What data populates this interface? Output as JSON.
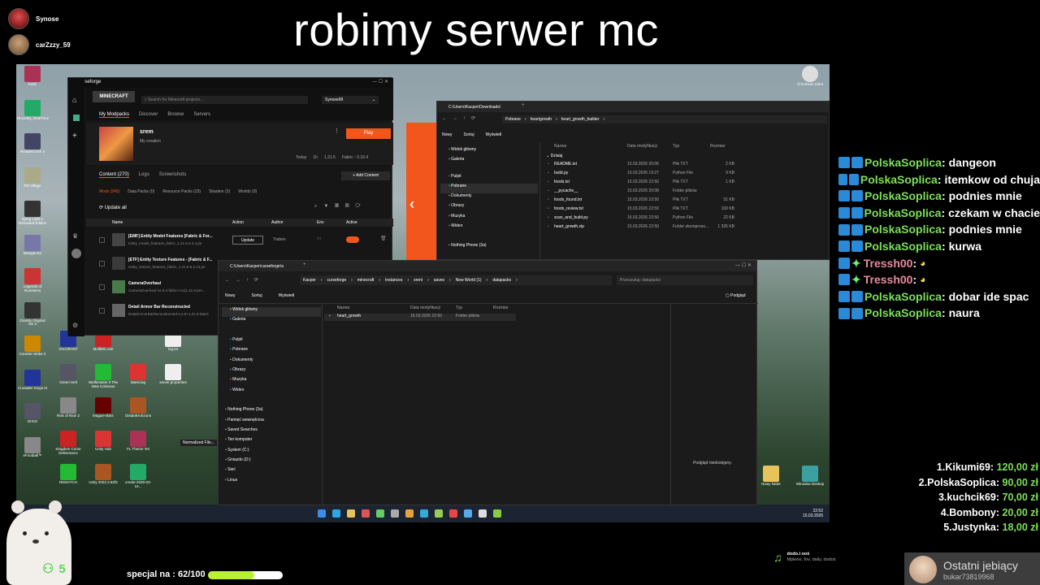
{
  "stream": {
    "title": "robimy serwer mc",
    "viewers": [
      {
        "name": "Synose"
      },
      {
        "name": "carZzzy_59"
      }
    ],
    "viewer_count": "5",
    "goal_text": "specjal na : 62/100",
    "goal_progress": 0.62,
    "music_title": "dodo.i ooś",
    "music_sub": "Mplene, fov, daily, dodoś",
    "last_donor_title": "Ostatni jebiący",
    "last_donor_name": "bukar73819968"
  },
  "chat": [
    {
      "user": "PolskaSoplica",
      "text": "dangeon",
      "color": "#7ce05a"
    },
    {
      "user": "PolskaSoplica",
      "text": "itemkow od chuja",
      "color": "#7ce05a"
    },
    {
      "user": "PolskaSoplica",
      "text": "podnies mnie",
      "color": "#7ce05a"
    },
    {
      "user": "PolskaSoplica",
      "text": "czekam w chacie",
      "color": "#7ce05a"
    },
    {
      "user": "PolskaSoplica",
      "text": "podnies mnie",
      "color": "#7ce05a"
    },
    {
      "user": "PolskaSoplica",
      "text": "kurwa",
      "color": "#7ce05a"
    },
    {
      "user": "Tressh00",
      "text": "",
      "color": "#e88aa0"
    },
    {
      "user": "Tressh00",
      "text": "",
      "color": "#e88aa0"
    },
    {
      "user": "PolskaSoplica",
      "text": "dobar ide spac",
      "color": "#7ce05a"
    },
    {
      "user": "PolskaSoplica",
      "text": "naura",
      "color": "#7ce05a"
    }
  ],
  "leaderboard": [
    {
      "rank": "1.",
      "name": "Kikumi69",
      "amount": "120,00 zł"
    },
    {
      "rank": "2.",
      "name": "PolskaSoplica",
      "amount": "90,00 zł"
    },
    {
      "rank": "3.",
      "name": "kuchcik69",
      "amount": "70,00 zł"
    },
    {
      "rank": "4.",
      "name": "Bombony",
      "amount": "20,00 zł"
    },
    {
      "rank": "5.",
      "name": "Justynka",
      "amount": "18,00 zł"
    }
  ],
  "curseforge": {
    "app_name": "curseforge",
    "search_placeholder": "Search for Minecraft projects...",
    "user": "Synose99",
    "tabs": [
      "My Modpacks",
      "Discover",
      "Browse",
      "Servers"
    ],
    "modpack_name": "srem",
    "modpack_sub": "My creation",
    "play_label": "Play",
    "meta": [
      "Today",
      "1h",
      "1.21.5",
      "Fabric - 0.16.4"
    ],
    "content_tabs": [
      "Content (270)",
      "Logs",
      "Screenshots"
    ],
    "add_content": "+ Add Content",
    "filter_tabs": [
      "Mods (245)",
      "Data Packs (0)",
      "Resource Packs (23)",
      "Shaders (2)",
      "Worlds (0)"
    ],
    "update_all": "Update all",
    "columns": [
      "Name",
      "Action",
      "Author",
      "Env",
      "Active"
    ],
    "mods": [
      {
        "name": "[EMF] Entity Model Features [Fabric & For...",
        "file": "entity_model_features_fabric_1.21.5-2.4.4.jar",
        "action": "Update",
        "author": "Traben"
      },
      {
        "name": "[ETF] Entity Texture Features - [Fabric & F...",
        "file": "entity_texture_features_fabric_1.21.5-6.2.13.jar",
        "action": "",
        "author": ""
      },
      {
        "name": "CameraOverhaul",
        "file": "CameraOverhaul-v2.0.4-fabric+mc[1.21.5-pre...",
        "action": "",
        "author": ""
      },
      {
        "name": "Detail Armor Bar Reconstructed",
        "file": "DetailArmorBarReconstructed-4.2.5+1.21.5-fabric",
        "action": "",
        "author": ""
      }
    ]
  },
  "explorer1": {
    "path_title": "C:\\Users\\Kacper\\Downloads\\",
    "breadcrumb": [
      "Pobrane",
      "heartgrowth",
      "heart_growth_builder"
    ],
    "toolbar": [
      "Nowy",
      "Sortuj",
      "Wyświetl"
    ],
    "nav": [
      "Widok główny",
      "Galeria",
      "Pulpit",
      "Pobrane",
      "Dokumenty",
      "Obrazy",
      "Muzyka",
      "Wideo",
      "Nothing Phone (3a)"
    ],
    "columns": [
      "Nazwa",
      "Data modyfikacji",
      "Typ",
      "Rozmiar"
    ],
    "group": "Dzisiaj",
    "files": [
      {
        "name": "README.txt",
        "date": "15.03.2026 20:06",
        "type": "Plik TXT",
        "size": "2 KB"
      },
      {
        "name": "build.py",
        "date": "15.03.2026 19:27",
        "type": "Python File",
        "size": "9 KB"
      },
      {
        "name": "foods.txt",
        "date": "15.03.2026 22:50",
        "type": "Plik TXT",
        "size": "1 KB"
      },
      {
        "name": "__pycache__",
        "date": "15.03.2026 20:08",
        "type": "Folder plików",
        "size": ""
      },
      {
        "name": "foods_found.txt",
        "date": "15.03.2026 22:50",
        "type": "Plik TXT",
        "size": "31 KB"
      },
      {
        "name": "foods_review.txt",
        "date": "15.03.2026 22:50",
        "type": "Plik TXT",
        "size": "100 KB"
      },
      {
        "name": "scan_and_build.py",
        "date": "15.03.2026 22:50",
        "type": "Python File",
        "size": "22 KB"
      },
      {
        "name": "heart_growth.zip",
        "date": "15.03.2026 22:50",
        "type": "Folder skompreso...",
        "size": "1 335 KB"
      }
    ]
  },
  "explorer2": {
    "path_title": "C:\\Users\\Kacper\\curseforge\\a",
    "breadcrumb": [
      "Kacper",
      "curseforge",
      "minecraft",
      "Instances",
      "srem",
      "saves",
      "New World (1)",
      "datapacks"
    ],
    "search_placeholder": "Przeszukaj: datapacks",
    "toolbar": [
      "Nowy",
      "Sortuj",
      "Wyświetl"
    ],
    "details": "Podgląd",
    "nav": [
      "Widok główny",
      "Galeria",
      "Pulpit",
      "Pobrane",
      "Dokumenty",
      "Obrazy",
      "Muzyka",
      "Wideo",
      "Nothing Phone (3a)",
      "Pamięć wewnętrzna",
      "Saved Searches",
      "Ten komputer",
      "System (C:)",
      "Gniazdo (D:)",
      "Sieć",
      "Linux"
    ],
    "columns": [
      "Nazwa",
      "Data modyfikacji",
      "Typ",
      "Rozmiar"
    ],
    "files": [
      {
        "name": "heart_growth",
        "date": "15.03.2026 22:50",
        "type": "Folder plików",
        "size": ""
      }
    ],
    "preview_text": "Podgląd niedostępny."
  },
  "desktop": {
    "icons_col1": [
      "Kosz",
      "Recently_RealTime",
      "Resident Evil 4",
      "RE:Village",
      "Dying Light 2 Reloaded Edition",
      "Mewgenics",
      "Legends of Runeterra",
      "Divinity Original Sin 2",
      "Counter-Strike 2",
      "Crusader Kings III",
      "DIXIO",
      "eFootball™"
    ],
    "icons_col2": [
      "VALORANT",
      "Green Hell",
      "Risk of Rain 2",
      "Kingdom Come Deliverance",
      "REMATCH"
    ],
    "icons_col3": [
      "MultiMC.exe",
      "Wolfenstein II The New Colossus",
      "league-skins",
      "Unity Hub",
      "Unity 2022.3.62f3"
    ],
    "icons_col4": [
      "latest.log",
      "DistantHorizons",
      "FL Theme Yet",
      "create-2026-03-14..."
    ],
    "icons_col5": [
      "log.txt",
      "server.properties"
    ],
    "right_icons": [
      "Chromium Ident",
      "Nowy folder",
      "Wirualna Deskop"
    ],
    "clock_time": "22:52",
    "clock_date": "15.03.2026",
    "normalized_label": "Normalized File..."
  }
}
